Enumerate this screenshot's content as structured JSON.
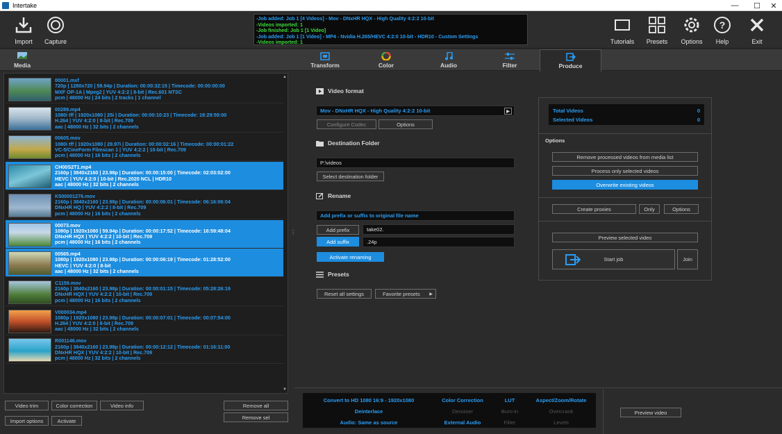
{
  "window": {
    "title": "Intertake",
    "minimize": "—",
    "maximize": "☐",
    "close": "✕"
  },
  "toolbar": {
    "import": "Import",
    "capture": "Capture",
    "tutorials": "Tutorials",
    "presets": "Presets",
    "options": "Options",
    "help": "Help",
    "exit": "Exit"
  },
  "log": [
    {
      "text": "-Job added: Job 1 [4 Videos] -  Mov - DNxHR HQX - High Quality 4:2:2 10-bit",
      "color": "#2a9df4"
    },
    {
      "text": "-Videos imported: 1",
      "color": "#3ddc3d"
    },
    {
      "text": "-Job finished: Job 1 [1 Video]",
      "color": "#3ddc3d"
    },
    {
      "text": "-Job added: Job 1 [1 Video] -  MP4 - Nvidia H.265/HEVC 4:2:0 10-bit - HDR10 - Custom Settings",
      "color": "#2a9df4"
    },
    {
      "text": "-Videos imported: 1",
      "color": "#3ddc3d"
    }
  ],
  "tabs": {
    "media": "Media",
    "transform": "Transform",
    "color": "Color",
    "audio": "Audio",
    "filter": "Filter",
    "produce": "Produce"
  },
  "media_items": [
    {
      "name": "00001.mxf",
      "l1": "720p | 1280x720 | 59.94p  | Duration:  00:00:32:15 | Timecode: 00:00:00:00",
      "l2": "MXF OP-1A | Mpeg2 | YUV 4:2:2 | 8-bit | Rec.601 NTSC",
      "l3": "pcm | 48000 Hz | 24 bits | 2 tracks | 1 channel",
      "selected": false
    },
    {
      "name": "00289.mp4",
      "l1": "1080i tff | 1920x1080 | 25i | Duration: 00:00:10:23 | Timecode: 18:29:59:00",
      "l2": "H.264 | YUV 4:2:0 | 8-bit  |  Rec.709",
      "l3": "aac | 48000 Hz | 32 bits | 2 channels",
      "selected": false
    },
    {
      "name": "00605.mov",
      "l1": "1080i tff | 1920x1080 | 29.97i  | Duration: 00:00:02:16 | Timecode: 00:00:01:22",
      "l2": "VC-5/CineForm Filmscan 1 | YUV 4:2:2 | 10-bit  |  Rec.709",
      "l3": "pcm | 48000 Hz | 16 bits | 2 channels",
      "selected": false
    },
    {
      "name": "CH00S2T1.mp4",
      "l1": "2160p | 3840x2160 | 23.98p  | Duration: 00:00:15:00 | Timecode: 02:03:02:00",
      "l2": "HEVC | YUV 4:2:0 | 10-bit |  Rec.2020 NCL | HDR10",
      "l3": "aac | 48000 Hz | 32 bits | 2 channels",
      "selected": true
    },
    {
      "name": "K500001276.mov",
      "l1": "2160p | 3840x2160 | 23.98p  | Duration: 00:00:06:01 | Timecode: 06:16:06:04",
      "l2": "DNxHR HQ | YUV 4:2:2 | 8-bit |  Rec.709",
      "l3": "pcm | 48000 Hz | 16 bits | 2 channels",
      "selected": false
    },
    {
      "name": "00073.mov",
      "l1": "1080p | 1920x1080 | 59.94p  | Duration: 00:00:17:52 | Timecode: 16:59:48:04",
      "l2": "DNxHR HQX | YUV 4:2:2 | 10-bit |  Rec.709",
      "l3": "pcm | 48000 Hz | 16 bits | 2 channels",
      "selected": true
    },
    {
      "name": "00565.mp4",
      "l1": "1080p | 1920x1080 | 23.98p  | Duration:  00:00:06:19 | Timecode: 01:28:52:00",
      "l2": "HEVC | YUV 4:2:0 | 8-bit",
      "l3": "aac | 48000 Hz | 32 bits | 2 channels",
      "selected": true
    },
    {
      "name": "C1159.mov",
      "l1": "2160p | 3840x2160 | 23.98p  | Duration: 00:00:01:15 | Timecode: 05:28:26:19",
      "l2": "DNxHR HQX | YUV 4:2:2 | 10-bit |  Rec.709",
      "l3": "pcm | 48000 Hz | 16 bits | 2 channels",
      "selected": false
    },
    {
      "name": "V000034.mp4",
      "l1": "1080p | 1920x1080 | 23.98p  | Duration: 00:00:07:01 | Timecode: 00:07:54:00",
      "l2": "H.264 | YUV 4:2:0 | 8-bit |  Rec.709",
      "l3": "aac | 48000 Hz | 32 bits | 2 channels",
      "selected": false
    },
    {
      "name": "R001146.mov",
      "l1": "2160p | 3840x2160 | 23.98p  | Duration: 00:00:12:12 | Timecode: 01:16:11:00",
      "l2": "DNxHR HQX | YUV 4:2:2 | 10-bit |  Rec.709",
      "l3": "pcm | 48000 Hz | 32 bits | 2 channels",
      "selected": false
    }
  ],
  "media_buttons": {
    "video_trim": "Video trim",
    "color_correction": "Color correction",
    "video_info": "Video info",
    "remove_all": "Remove all",
    "import_options": "Import options",
    "activate": "Activate",
    "remove_sel": "Remove sel"
  },
  "produce": {
    "video_format_title": "Video format",
    "video_format_value": "Mov - DNxHR HQX - High Quality 4:2:2 10-bit",
    "configure_codec": "Configure Codec",
    "options": "Options",
    "destination_title": "Destination Folder",
    "destination_value": "P:\\videos",
    "select_destination": "Select destination folder",
    "rename_title": "Rename",
    "rename_hint": "Add prefix or suffix to original file name",
    "add_prefix": "Add prefix",
    "prefix_value": "take02.",
    "add_suffix": "Add suffix",
    "suffix_value": ".24p",
    "activate_renaming": "Activate renaming",
    "presets_title": "Presets",
    "reset_all": "Reset all settings",
    "favorite_presets": "Favorite presets"
  },
  "right_panel": {
    "total_videos_label": "Total Videos",
    "total_videos": "0",
    "selected_videos_label": "Selected Videos",
    "selected_videos": "0",
    "options_title": "Options",
    "remove_processed": "Remove processed videos from media list",
    "process_only_selected": "Process only selected videos",
    "overwrite_existing": "Overwrite existing videos",
    "create_proxies": "Create proxies",
    "only": "Only",
    "options": "Options",
    "preview_selected": "Preview selected video",
    "start_job": "Start  job",
    "join": "Join"
  },
  "summary": {
    "r1": [
      "Convert to HD 1080 16:9 - 1920x1080",
      "Color Correction",
      "LUT",
      "Aspect/Zoom/Rotate"
    ],
    "r2": [
      "Deinterlace",
      "Denoiser",
      "Burn-in",
      "Overcrank"
    ],
    "r3": [
      "Audio: Same as source",
      "External Audio",
      "Filter",
      "Levels"
    ],
    "preview_video": "Preview video"
  },
  "colors": {
    "accent": "#1d8ddf",
    "text_blue": "#2a9df4",
    "log_green": "#3ddc3d"
  }
}
